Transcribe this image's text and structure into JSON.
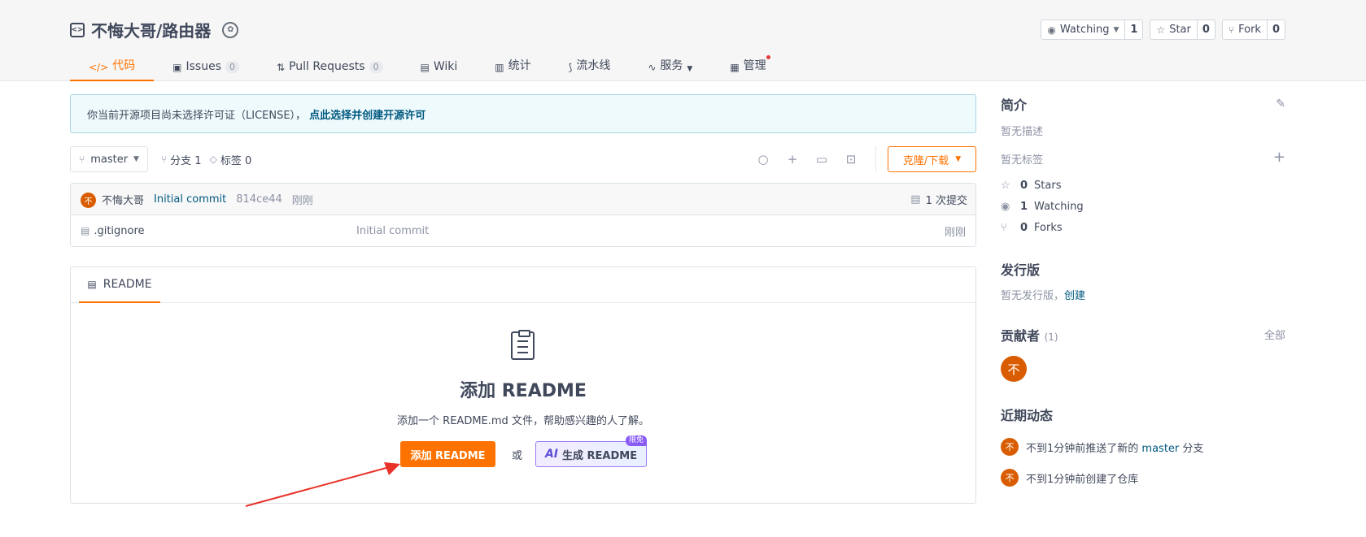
{
  "repo": {
    "title": "不悔大哥/路由器"
  },
  "actions": {
    "watch_label": "Watching",
    "watch_count": "1",
    "star_label": "Star",
    "star_count": "0",
    "fork_label": "Fork",
    "fork_count": "0"
  },
  "tabs": [
    {
      "label": "代码"
    },
    {
      "label": "Issues",
      "count": "0"
    },
    {
      "label": "Pull Requests",
      "count": "0"
    },
    {
      "label": "Wiki"
    },
    {
      "label": "统计"
    },
    {
      "label": "流水线"
    },
    {
      "label": "服务"
    },
    {
      "label": "管理"
    }
  ],
  "license": {
    "text": "你当前开源项目尚未选择许可证（LICENSE），",
    "link": "点此选择并创建开源许可"
  },
  "toolbar": {
    "branch": "master",
    "branches": "分支 1",
    "tags": "标签 0",
    "clone": "克隆/下载"
  },
  "commit": {
    "avatar": "不",
    "author": "不悔大哥",
    "message": "Initial commit",
    "sha": "814ce44",
    "time": "刚刚",
    "count": "1 次提交"
  },
  "files": [
    {
      "name": ".gitignore",
      "message": "Initial commit",
      "time": "刚刚"
    }
  ],
  "readme": {
    "tab": "README",
    "title": "添加 README",
    "desc": "添加一个 README.md 文件，帮助感兴趣的人了解。",
    "add_btn": "添加 README",
    "or": "或",
    "ai_mark": "AI",
    "ai_btn": "生成 README",
    "ai_tag": "限免"
  },
  "sidebar": {
    "intro_title": "简介",
    "no_desc": "暂无描述",
    "no_tags": "暂无标签",
    "stars": {
      "count": "0",
      "label": "Stars"
    },
    "watching": {
      "count": "1",
      "label": "Watching"
    },
    "forks": {
      "count": "0",
      "label": "Forks"
    },
    "release_title": "发行版",
    "no_release": "暂无发行版，",
    "create": "创建",
    "contrib_title": "贡献者",
    "contrib_count": "(1)",
    "all": "全部",
    "contrib_avatar": "不",
    "activity_title": "近期动态",
    "activity": [
      {
        "avatar": "不",
        "prefix": "不到1分钟前推送了新的",
        "branch": "master",
        "suffix": "分支"
      },
      {
        "avatar": "不",
        "prefix": "不到1分钟前创建了仓库"
      }
    ]
  },
  "colors": {
    "accent": "#fe7300",
    "link": "#005980",
    "avatar": "#d95d00"
  }
}
